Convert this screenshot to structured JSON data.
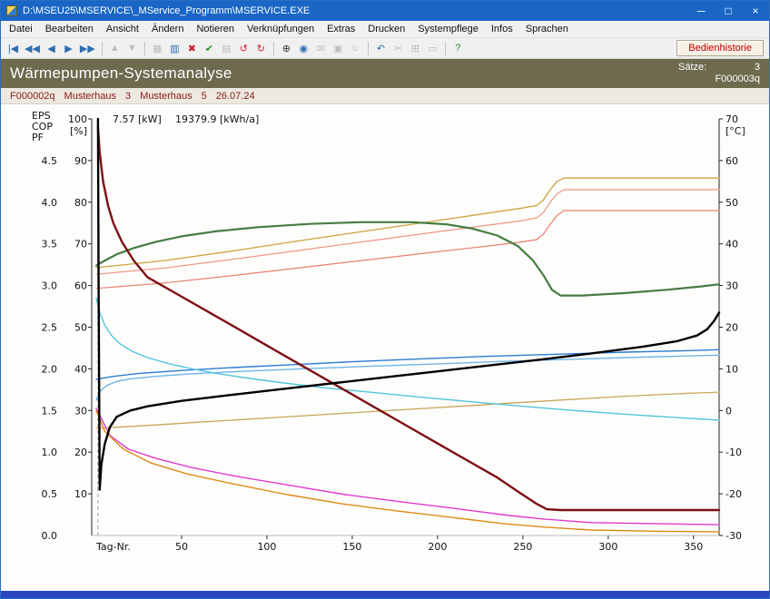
{
  "window": {
    "title": "D:\\MSEU25\\MSERVICE\\_MService_Programm\\MSERVICE.EXE",
    "controls": {
      "minimize": "─",
      "maximize": "□",
      "close": "×"
    }
  },
  "menu": {
    "items": [
      "Datei",
      "Bearbeiten",
      "Ansicht",
      "Ändern",
      "Notieren",
      "Verknüpfungen",
      "Extras",
      "Drucken",
      "Systempflege",
      "Infos",
      "Sprachen"
    ]
  },
  "toolbar": {
    "history_button": "Bedienhistorie",
    "groups": [
      [
        {
          "name": "first-record",
          "glyph": "|◀",
          "color": "#2d6db0",
          "enabled": true
        },
        {
          "name": "prev-fast",
          "glyph": "◀◀",
          "color": "#2d6db0",
          "enabled": true
        },
        {
          "name": "prev-record",
          "glyph": "◀",
          "color": "#2d6db0",
          "enabled": true
        },
        {
          "name": "next-record",
          "glyph": "▶",
          "color": "#2d6db0",
          "enabled": true
        },
        {
          "name": "next-fast",
          "glyph": "▶▶",
          "color": "#2d6db0",
          "enabled": true
        }
      ],
      [
        {
          "name": "sort-up",
          "glyph": "▲",
          "color": "#777777",
          "enabled": false
        },
        {
          "name": "sort-down",
          "glyph": "▼",
          "color": "#777777",
          "enabled": false
        }
      ],
      [
        {
          "name": "save",
          "glyph": "▦",
          "color": "#777777",
          "enabled": false
        },
        {
          "name": "table-view",
          "glyph": "▥",
          "color": "#2d6db0",
          "enabled": true
        },
        {
          "name": "delete",
          "glyph": "✖",
          "color": "#cc2222",
          "enabled": true
        },
        {
          "name": "confirm",
          "glyph": "✔",
          "color": "#2a8a2a",
          "enabled": true
        },
        {
          "name": "new-document",
          "glyph": "▤",
          "color": "#777777",
          "enabled": false
        },
        {
          "name": "revert",
          "glyph": "↺",
          "color": "#cc2222",
          "enabled": true
        },
        {
          "name": "refresh",
          "glyph": "↻",
          "color": "#cc2222",
          "enabled": true
        }
      ],
      [
        {
          "name": "search",
          "glyph": "⊕",
          "color": "#333333",
          "enabled": true
        },
        {
          "name": "view-eye",
          "glyph": "◉",
          "color": "#2d6db0",
          "enabled": true
        },
        {
          "name": "mail",
          "glyph": "✉",
          "color": "#777777",
          "enabled": false
        },
        {
          "name": "print",
          "glyph": "▣",
          "color": "#777777",
          "enabled": false
        },
        {
          "name": "smiley",
          "glyph": "☺",
          "color": "#777777",
          "enabled": false
        }
      ],
      [
        {
          "name": "undo",
          "glyph": "↶",
          "color": "#2d6db0",
          "enabled": true
        },
        {
          "name": "cut",
          "glyph": "✂",
          "color": "#777777",
          "enabled": false
        },
        {
          "name": "copy",
          "glyph": "⊞",
          "color": "#777777",
          "enabled": false
        },
        {
          "name": "paste",
          "glyph": "▭",
          "color": "#777777",
          "enabled": false
        }
      ],
      [
        {
          "name": "help",
          "glyph": "?",
          "color": "#2a8a2a",
          "enabled": true
        }
      ]
    ]
  },
  "banner": {
    "title": "Wärmepumpen-Systemanalyse",
    "saetze_label": "Sätze:",
    "saetze_value": "3",
    "record_code": "F000003q"
  },
  "record_bar": {
    "parts": [
      "F000002q",
      "Musterhaus",
      "3",
      "Musterhaus",
      "5",
      "26.07.24"
    ]
  },
  "chart_data": {
    "type": "line",
    "xlabel": "Tag-Nr.",
    "x_range": [
      0,
      365
    ],
    "x_ticks": [
      50,
      100,
      150,
      200,
      250,
      300,
      350
    ],
    "marker_day": 1,
    "grid": false,
    "legend": "none",
    "annotation": {
      "power": "7.57 [kW]",
      "energy": "19379.9 [kWh/a]"
    },
    "left_axis": {
      "header": [
        "EPS",
        "COP",
        "PF"
      ],
      "unit": "[%]",
      "pct_ticks": [
        100,
        90,
        80,
        70,
        60,
        50,
        40,
        30,
        20,
        10
      ],
      "eps_rows": [
        {
          "pct": 90,
          "label": "4.5"
        },
        {
          "pct": 80,
          "label": "4.0"
        },
        {
          "pct": 70,
          "label": "3.5"
        },
        {
          "pct": 60,
          "label": "3.0"
        },
        {
          "pct": 50,
          "label": "2.5"
        },
        {
          "pct": 40,
          "label": "2.0"
        },
        {
          "pct": 30,
          "label": "1.5"
        },
        {
          "pct": 20,
          "label": "1.0"
        },
        {
          "pct": 10,
          "label": "0.5"
        },
        {
          "pct": 0,
          "label": "0.0"
        }
      ],
      "eps_range": [
        0,
        5
      ],
      "pct_range": [
        0,
        100
      ]
    },
    "right_axis": {
      "unit": "[°C]",
      "ticks": [
        70,
        60,
        50,
        40,
        30,
        20,
        10,
        0,
        -10,
        -20,
        -30
      ],
      "range": [
        -30,
        70
      ]
    },
    "units_note": "series values are percent of left axis; temperature = percent - 30 °C",
    "series": [
      {
        "name": "gold-upper-curve",
        "color": "#cfa13c",
        "width": 1.3,
        "points": [
          [
            0,
            64.3
          ],
          [
            40,
            66
          ],
          [
            80,
            68.3
          ],
          [
            120,
            70.8
          ],
          [
            160,
            73.2
          ],
          [
            200,
            75.6
          ],
          [
            230,
            77.4
          ],
          [
            248,
            78.5
          ],
          [
            258,
            79.2
          ],
          [
            262,
            80.5
          ],
          [
            266,
            83
          ],
          [
            270,
            85
          ],
          [
            274,
            85.8
          ],
          [
            365,
            85.8
          ]
        ]
      },
      {
        "name": "salmon-upper-curve",
        "color": "#ee9480",
        "width": 1.2,
        "points": [
          [
            0,
            62.7
          ],
          [
            40,
            64.2
          ],
          [
            80,
            66.3
          ],
          [
            120,
            68.5
          ],
          [
            160,
            70.7
          ],
          [
            200,
            72.9
          ],
          [
            230,
            74.5
          ],
          [
            248,
            75.5
          ],
          [
            258,
            76.2
          ],
          [
            262,
            77.5
          ],
          [
            266,
            80
          ],
          [
            270,
            82
          ],
          [
            274,
            83
          ],
          [
            365,
            83
          ]
        ]
      },
      {
        "name": "salmon-lower-curve",
        "color": "#e87f6d",
        "width": 1.2,
        "points": [
          [
            0,
            59.3
          ],
          [
            40,
            60.6
          ],
          [
            80,
            62.4
          ],
          [
            120,
            64.3
          ],
          [
            160,
            66.2
          ],
          [
            200,
            68.1
          ],
          [
            230,
            69.5
          ],
          [
            248,
            70.4
          ],
          [
            258,
            71
          ],
          [
            262,
            72.3
          ],
          [
            266,
            74.7
          ],
          [
            270,
            76.8
          ],
          [
            274,
            78
          ],
          [
            365,
            78
          ]
        ]
      },
      {
        "name": "tan-lower-curve",
        "color": "#c9a658",
        "width": 1.3,
        "points": [
          [
            0,
            25.7
          ],
          [
            30,
            26.4
          ],
          [
            60,
            27.2
          ],
          [
            100,
            28.2
          ],
          [
            140,
            29.2
          ],
          [
            180,
            30.2
          ],
          [
            220,
            31.2
          ],
          [
            260,
            32.2
          ],
          [
            300,
            33.2
          ],
          [
            340,
            34
          ],
          [
            365,
            34.4
          ]
        ]
      },
      {
        "name": "blue-curve",
        "color": "#2d7cd2",
        "width": 1.4,
        "points": [
          [
            0,
            37.5
          ],
          [
            10,
            38.2
          ],
          [
            25,
            38.9
          ],
          [
            50,
            39.6
          ],
          [
            80,
            40.3
          ],
          [
            115,
            41
          ],
          [
            150,
            41.7
          ],
          [
            190,
            42.4
          ],
          [
            230,
            43
          ],
          [
            270,
            43.5
          ],
          [
            310,
            44
          ],
          [
            340,
            44.3
          ],
          [
            365,
            44.6
          ]
        ]
      },
      {
        "name": "light-blue-curve",
        "color": "#6fb4e8",
        "width": 1.4,
        "points": [
          [
            0,
            32.5
          ],
          [
            2,
            34.5
          ],
          [
            6,
            36
          ],
          [
            12,
            37
          ],
          [
            20,
            37.6
          ],
          [
            35,
            38.2
          ],
          [
            55,
            38.8
          ],
          [
            85,
            39.4
          ],
          [
            120,
            40
          ],
          [
            160,
            40.6
          ],
          [
            200,
            41.2
          ],
          [
            240,
            41.8
          ],
          [
            280,
            42.3
          ],
          [
            320,
            42.8
          ],
          [
            365,
            43.3
          ]
        ]
      },
      {
        "name": "cyan-curve",
        "color": "#52c5da",
        "width": 1.4,
        "points": [
          [
            0,
            57
          ],
          [
            2,
            53.5
          ],
          [
            5,
            50.5
          ],
          [
            9,
            48
          ],
          [
            14,
            46
          ],
          [
            21,
            44.2
          ],
          [
            30,
            42.7
          ],
          [
            42,
            41.3
          ],
          [
            56,
            40
          ],
          [
            72,
            38.8
          ],
          [
            90,
            37.7
          ],
          [
            110,
            36.6
          ],
          [
            135,
            35.4
          ],
          [
            160,
            34.4
          ],
          [
            190,
            33.2
          ],
          [
            220,
            32.1
          ],
          [
            250,
            31
          ],
          [
            280,
            30
          ],
          [
            310,
            29.1
          ],
          [
            340,
            28.3
          ],
          [
            365,
            27.7
          ]
        ]
      },
      {
        "name": "magenta-curve",
        "color": "#e03ccc",
        "width": 1.4,
        "points": [
          [
            0,
            30.5
          ],
          [
            8,
            24
          ],
          [
            19,
            20.7
          ],
          [
            35,
            18.5
          ],
          [
            56,
            16.3
          ],
          [
            82,
            14.2
          ],
          [
            114,
            12
          ],
          [
            146,
            9.8
          ],
          [
            178,
            8.1
          ],
          [
            210,
            6.5
          ],
          [
            242,
            4.8
          ],
          [
            263,
            3.9
          ],
          [
            290,
            3.1
          ],
          [
            330,
            2.8
          ],
          [
            365,
            2.6
          ]
        ]
      },
      {
        "name": "orange-curve",
        "color": "#de8a12",
        "width": 1.4,
        "points": [
          [
            0,
            30
          ],
          [
            5,
            25
          ],
          [
            16,
            20.7
          ],
          [
            32,
            17.4
          ],
          [
            53,
            14.8
          ],
          [
            80,
            12.4
          ],
          [
            112,
            9.8
          ],
          [
            144,
            7.6
          ],
          [
            176,
            5.9
          ],
          [
            207,
            4.4
          ],
          [
            239,
            2.8
          ],
          [
            263,
            2
          ],
          [
            290,
            1.3
          ],
          [
            330,
            1
          ],
          [
            365,
            0.9
          ]
        ]
      },
      {
        "name": "green-curve",
        "color": "#457c42",
        "width": 2.2,
        "points": [
          [
            0,
            64.8
          ],
          [
            5,
            66
          ],
          [
            12,
            67.5
          ],
          [
            22,
            69
          ],
          [
            35,
            70.5
          ],
          [
            50,
            71.8
          ],
          [
            70,
            73
          ],
          [
            95,
            74
          ],
          [
            125,
            74.8
          ],
          [
            155,
            75.2
          ],
          [
            185,
            75.2
          ],
          [
            205,
            74.7
          ],
          [
            220,
            73.7
          ],
          [
            235,
            72
          ],
          [
            247,
            69.5
          ],
          [
            256,
            66
          ],
          [
            262,
            62.5
          ],
          [
            267,
            59
          ],
          [
            272,
            57.6
          ],
          [
            285,
            57.6
          ],
          [
            310,
            58.2
          ],
          [
            335,
            59
          ],
          [
            355,
            59.8
          ],
          [
            365,
            60.3
          ]
        ]
      },
      {
        "name": "dark-red-curve",
        "color": "#7d0f12",
        "width": 2.4,
        "points": [
          [
            1,
            98
          ],
          [
            2,
            92
          ],
          [
            4,
            85
          ],
          [
            7,
            79
          ],
          [
            10,
            75
          ],
          [
            15,
            70.5
          ],
          [
            22,
            66
          ],
          [
            30,
            62
          ],
          [
            45,
            58.5
          ],
          [
            60,
            55
          ],
          [
            80,
            50.3
          ],
          [
            100,
            45.6
          ],
          [
            120,
            40.9
          ],
          [
            140,
            36.2
          ],
          [
            160,
            31.5
          ],
          [
            180,
            26.8
          ],
          [
            200,
            22.1
          ],
          [
            220,
            17.4
          ],
          [
            235,
            13.9
          ],
          [
            248,
            10.3
          ],
          [
            258,
            7.6
          ],
          [
            264,
            6.3
          ],
          [
            272,
            6.1
          ],
          [
            365,
            6.1
          ]
        ]
      },
      {
        "name": "black-curve",
        "color": "#000000",
        "width": 2.4,
        "points": [
          [
            1,
            100
          ],
          [
            1.4,
            60
          ],
          [
            2,
            11
          ],
          [
            3,
            17
          ],
          [
            5,
            22
          ],
          [
            8,
            26
          ],
          [
            12,
            28.5
          ],
          [
            20,
            30
          ],
          [
            30,
            31
          ],
          [
            50,
            32.3
          ],
          [
            80,
            33.8
          ],
          [
            110,
            35.2
          ],
          [
            140,
            36.6
          ],
          [
            170,
            38
          ],
          [
            200,
            39.4
          ],
          [
            230,
            40.8
          ],
          [
            260,
            42.2
          ],
          [
            290,
            43.7
          ],
          [
            320,
            45.3
          ],
          [
            340,
            46.6
          ],
          [
            352,
            48
          ],
          [
            358,
            49.5
          ],
          [
            362,
            51.5
          ],
          [
            365,
            53.5
          ]
        ]
      }
    ]
  }
}
